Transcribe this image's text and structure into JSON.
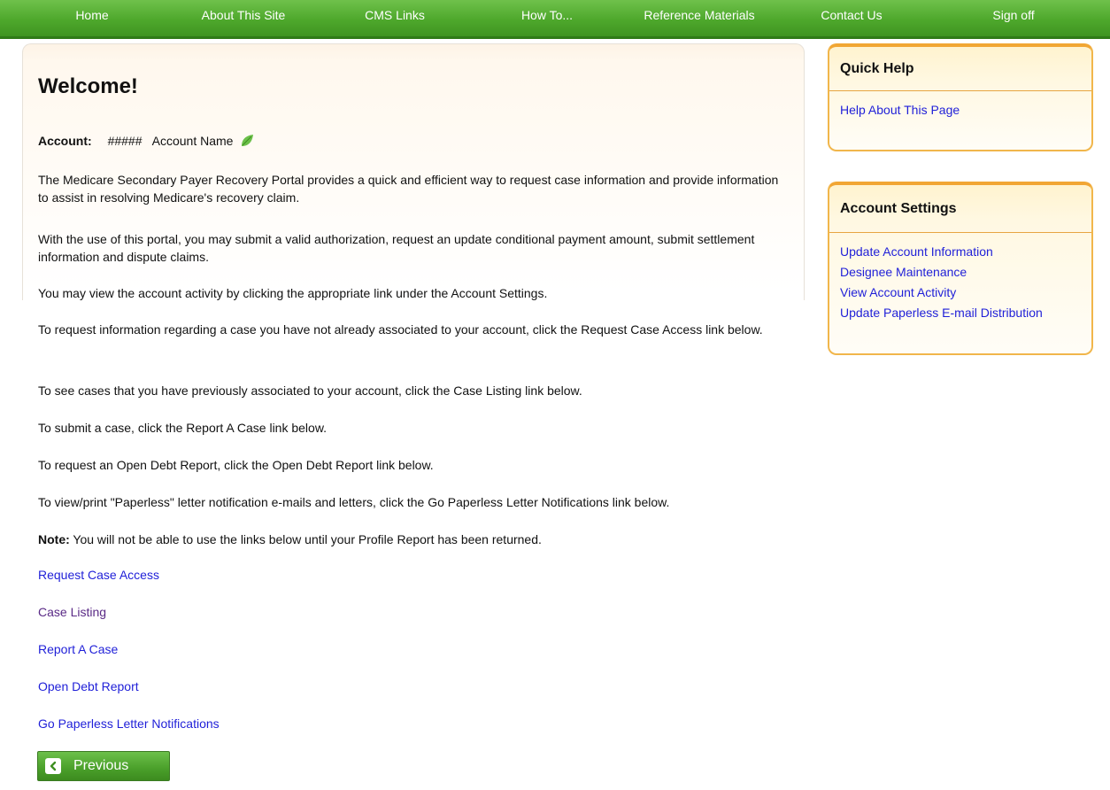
{
  "nav": {
    "items": [
      {
        "label": "Home"
      },
      {
        "label": "About This Site"
      },
      {
        "label": "CMS Links"
      },
      {
        "label": "How To..."
      },
      {
        "label": "Reference Materials"
      },
      {
        "label": "Contact Us"
      },
      {
        "label": "Sign off"
      }
    ]
  },
  "main": {
    "title": "Welcome!",
    "account": {
      "label": "Account:",
      "number": "#####",
      "name": "Account Name",
      "icon": "leaf-icon"
    },
    "paragraphs": [
      "The Medicare Secondary Payer Recovery Portal provides a quick and efficient way to request case information and provide information to assist in resolving Medicare's recovery claim.",
      "With the use of this portal, you may submit a valid authorization, request an update conditional payment amount, submit settlement information and dispute claims.",
      "You may view the account activity by clicking the appropriate link under the Account Settings.",
      "To request information regarding a case you have not already associated to your account, click the Request Case Access link below.",
      "To see cases that you have previously associated to your account, click the Case Listing link below.",
      "To submit a case, click the Report A Case link below.",
      "To request an Open Debt Report, click the Open Debt Report link below.",
      "To view/print \"Paperless\" letter notification e-mails and letters, click the Go Paperless Letter Notifications link below."
    ],
    "note": {
      "label": "Note:",
      "text": " You will not be able to use the links below until your Profile Report has been returned."
    },
    "links": [
      {
        "label": "Request Case Access"
      },
      {
        "label": "Case Listing"
      },
      {
        "label": "Report A Case"
      },
      {
        "label": "Open Debt Report"
      },
      {
        "label": "Go Paperless Letter Notifications"
      }
    ],
    "previous_button": {
      "label": "Previous",
      "icon": "chevron-left-icon"
    }
  },
  "quick_help": {
    "title": "Quick Help",
    "links": [
      {
        "label": "Help About This Page"
      }
    ]
  },
  "account_settings": {
    "title": "Account Settings",
    "links": [
      {
        "label": "Update Account Information"
      },
      {
        "label": "Designee Maintenance"
      },
      {
        "label": "View Account Activity"
      },
      {
        "label": "Update Paperless E-mail Distribution"
      }
    ]
  },
  "colors": {
    "nav_green": "#4ea82c",
    "link_blue": "#1f1fd8",
    "visited_purple": "#5a2a86",
    "side_box_border": "#f1b64b"
  }
}
